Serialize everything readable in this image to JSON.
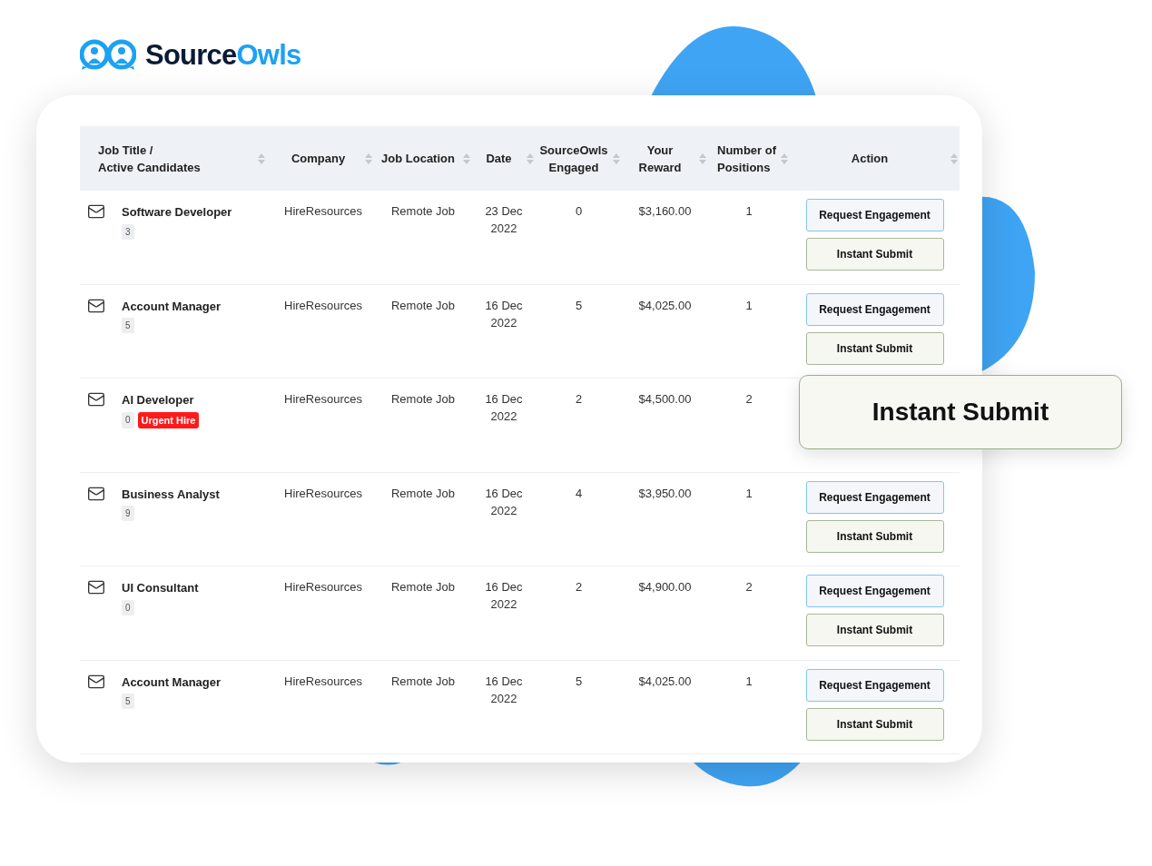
{
  "logo": {
    "text_dark": "Source",
    "text_accent": "Owls"
  },
  "table": {
    "columns": [
      {
        "lines": [
          "Job Title /",
          "Active Candidates"
        ]
      },
      {
        "lines": [
          "Company"
        ]
      },
      {
        "lines": [
          "Job Location"
        ]
      },
      {
        "lines": [
          "Date"
        ]
      },
      {
        "lines": [
          "SourceOwls",
          "Engaged"
        ]
      },
      {
        "lines": [
          "Your",
          "Reward"
        ]
      },
      {
        "lines": [
          "Number of",
          "Positions"
        ]
      },
      {
        "lines": [
          "Action"
        ]
      }
    ],
    "rows": [
      {
        "title": "Software Developer",
        "candidates": "3",
        "company": "HireResources",
        "location": "Remote Job",
        "date": "23 Dec 2022",
        "engaged": "0",
        "reward": "$3,160.00",
        "positions": "1",
        "actions": [
          {
            "label": "Request Engagement",
            "kind": "request"
          },
          {
            "label": "Instant Submit",
            "kind": "submit"
          }
        ]
      },
      {
        "title": "Account Manager",
        "candidates": "5",
        "company": "HireResources",
        "location": "Remote Job",
        "date": "16 Dec 2022",
        "engaged": "5",
        "reward": "$4,025.00",
        "positions": "1",
        "actions": [
          {
            "label": "Request Engagement",
            "kind": "request"
          },
          {
            "label": "Instant Submit",
            "kind": "submit"
          }
        ]
      },
      {
        "title": "AI Developer",
        "candidates": "0",
        "tag": "Urgent Hire",
        "company": "HireResources",
        "location": "Remote Job",
        "date": "16 Dec 2022",
        "engaged": "2",
        "reward": "$4,500.00",
        "positions": "2",
        "actions": []
      },
      {
        "title": "Business Analyst",
        "candidates": "9",
        "company": "HireResources",
        "location": "Remote Job",
        "date": "16 Dec 2022",
        "engaged": "4",
        "reward": "$3,950.00",
        "positions": "1",
        "actions": [
          {
            "label": "Request Engagement",
            "kind": "request"
          },
          {
            "label": "Instant Submit",
            "kind": "submit"
          }
        ]
      },
      {
        "title": "UI Consultant",
        "candidates": "0",
        "company": "HireResources",
        "location": "Remote Job",
        "date": "16 Dec 2022",
        "engaged": "2",
        "reward": "$4,900.00",
        "positions": "2",
        "actions": [
          {
            "label": "Request Engagement",
            "kind": "request"
          },
          {
            "label": "Instant Submit",
            "kind": "submit"
          }
        ]
      },
      {
        "title": "Account Manager",
        "candidates": "5",
        "company": "HireResources",
        "location": "Remote Job",
        "date": "16 Dec 2022",
        "engaged": "5",
        "reward": "$4,025.00",
        "positions": "1",
        "actions": [
          {
            "label": "Request Engagement",
            "kind": "request"
          },
          {
            "label": "Instant Submit",
            "kind": "submit"
          }
        ]
      }
    ]
  },
  "callout": {
    "label": "Instant Submit"
  }
}
